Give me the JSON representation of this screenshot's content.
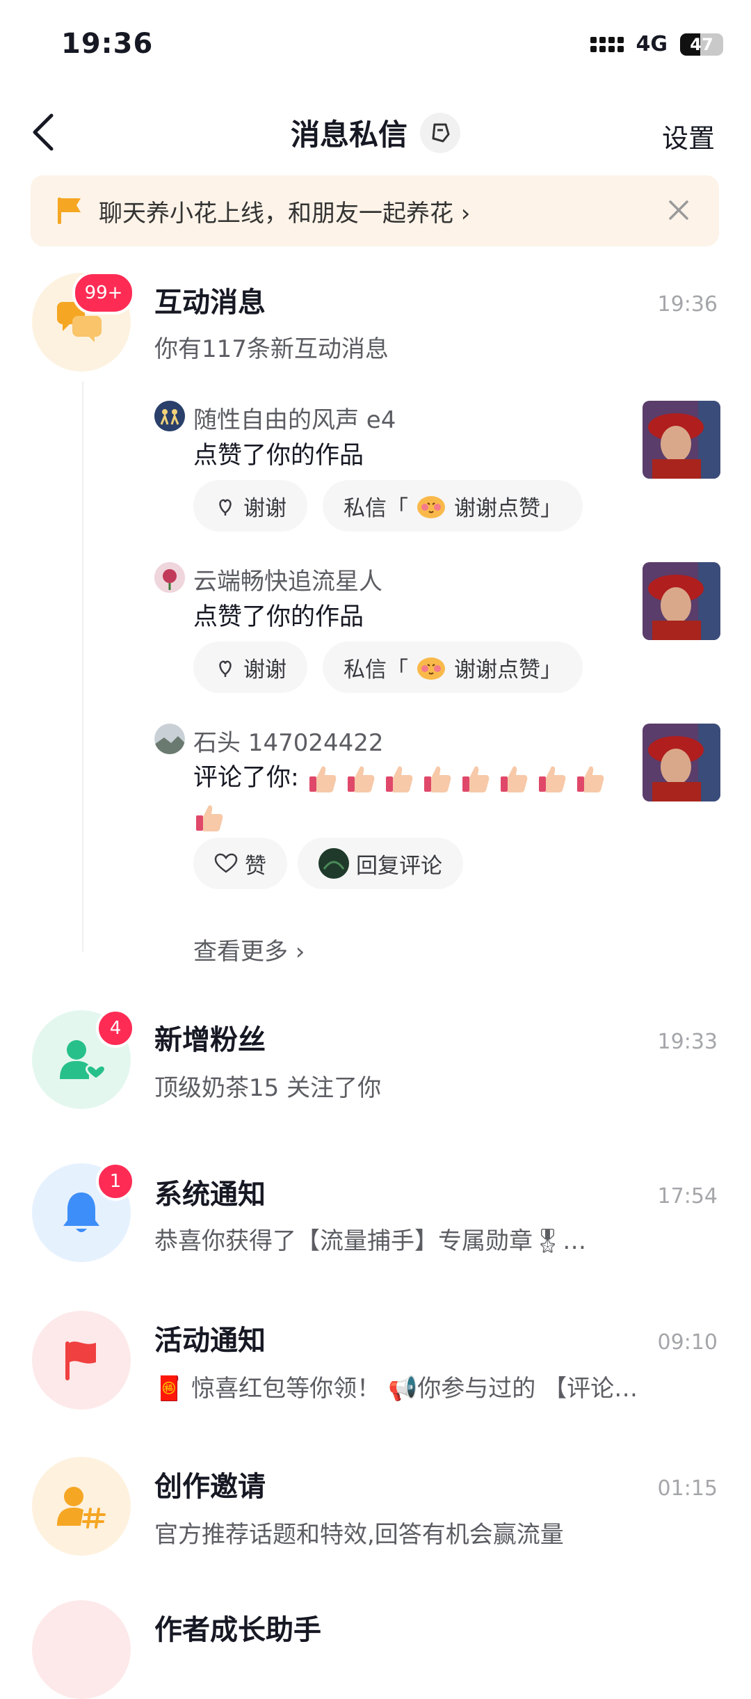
{
  "status_bar": {
    "time": "19:36",
    "network": "4G",
    "battery": "47",
    "battery_level": 0.47
  },
  "header": {
    "title": "消息私信",
    "settings_label": "设置"
  },
  "banner": {
    "text": "聊天养小花上线，和朋友一起养花 ›"
  },
  "interactions": {
    "title": "互动消息",
    "time": "19:36",
    "badge": "99+",
    "summary": "你有117条新互动消息",
    "items": [
      {
        "user": "随性自由的风声 e4",
        "action": "点赞了你的作品",
        "chip1": "谢谢",
        "chip2_pre": "私信「",
        "chip2_post": "谢谢点赞」"
      },
      {
        "user": "云端畅快追流星人",
        "action": "点赞了你的作品",
        "chip1": "谢谢",
        "chip2_pre": "私信「",
        "chip2_post": "谢谢点赞」"
      },
      {
        "user": "石头 147024422",
        "action": "评论了你:",
        "chip1": "赞",
        "chip2": "回复评论"
      }
    ],
    "more": "查看更多 ›"
  },
  "list": [
    {
      "title": "新增粉丝",
      "time": "19:33",
      "badge": "4",
      "sub": "顶级奶茶15 关注了你",
      "icon": "follower-icon"
    },
    {
      "title": "系统通知",
      "time": "17:54",
      "badge": "1",
      "sub": "恭喜你获得了【流量捕手】专属勋章🎖…",
      "icon": "bell-icon"
    },
    {
      "title": "活动通知",
      "time": "09:10",
      "sub": "🧧 惊喜红包等你领！ 📢你参与过的 【评论…",
      "icon": "flag-icon"
    },
    {
      "title": "创作邀请",
      "time": "01:15",
      "sub": "官方推荐话题和特效,回答有机会赢流量",
      "icon": "creator-icon"
    },
    {
      "title": "作者成长助手",
      "icon": "growth-icon"
    }
  ],
  "colors": {
    "accent": "#fe2c55",
    "orange": "#f5a623",
    "teal": "#27c08a",
    "blue": "#3d8ef8",
    "red": "#f04040"
  }
}
